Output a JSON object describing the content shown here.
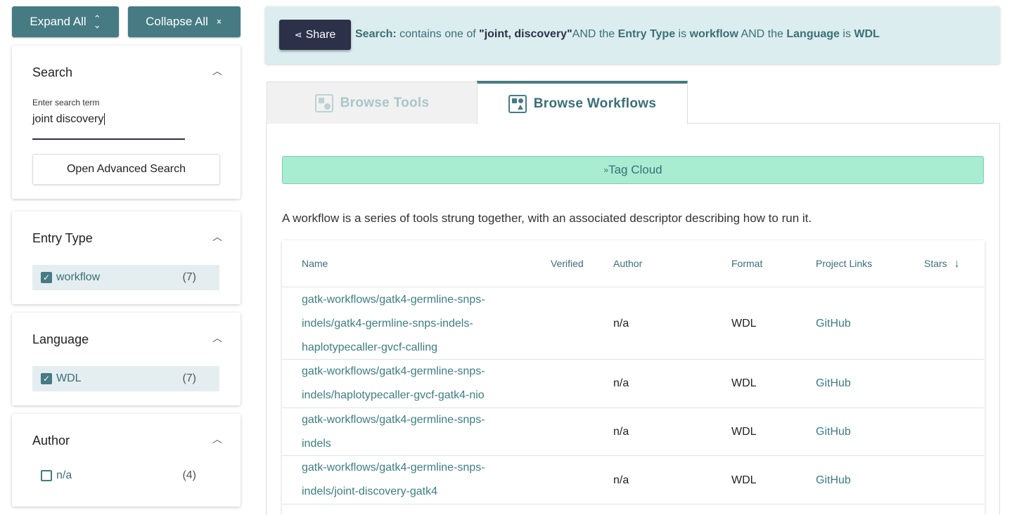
{
  "sidebar": {
    "expand_all": "Expand All",
    "collapse_all": "Collapse All",
    "search": {
      "title": "Search",
      "input_label": "Enter search term",
      "input_value": "joint discovery",
      "advanced_button": "Open Advanced Search"
    },
    "entry_type": {
      "title": "Entry Type",
      "items": [
        {
          "label": "workflow",
          "count": "(7)",
          "checked": true
        }
      ]
    },
    "language": {
      "title": "Language",
      "items": [
        {
          "label": "WDL",
          "count": "(7)",
          "checked": true
        }
      ]
    },
    "author": {
      "title": "Author",
      "items": [
        {
          "label": "n/a",
          "count": "(4)",
          "checked": false
        }
      ]
    }
  },
  "search_bar": {
    "share_label": "Share",
    "query_prefix": "Search:",
    "query_part1": " contains one of ",
    "query_terms": "\"joint, discovery\"",
    "query_part2": "AND the ",
    "entry_type_label": "Entry Type",
    "query_part3": " is ",
    "entry_type_value": "workflow",
    "query_part4": " AND the ",
    "language_label": "Language",
    "query_part5": " is ",
    "language_value": "WDL"
  },
  "tabs": [
    {
      "label": "Browse Tools",
      "active": false
    },
    {
      "label": "Browse Workflows",
      "active": true
    }
  ],
  "tag_cloud_label": "Tag Cloud",
  "description": "A workflow is a series of tools strung together, with an associated descriptor describing how to run it.",
  "table": {
    "headers": [
      "Name",
      "Verified",
      "Author",
      "Format",
      "Project Links",
      "Stars"
    ],
    "rows": [
      {
        "name_lines": [
          "gatk-workflows/gatk4-germline-snps-",
          "indels/gatk4-germline-snps-indels-",
          "haplotypecaller-gvcf-calling"
        ],
        "author": "n/a",
        "format": "WDL",
        "link": "GitHub"
      },
      {
        "name_lines": [
          "gatk-workflows/gatk4-germline-snps-",
          "indels/haplotypecaller-gvcf-gatk4-nio"
        ],
        "author": "n/a",
        "format": "WDL",
        "link": "GitHub"
      },
      {
        "name_lines": [
          "gatk-workflows/gatk4-germline-snps-",
          "indels"
        ],
        "author": "n/a",
        "format": "WDL",
        "link": "GitHub"
      },
      {
        "name_lines": [
          "gatk-workflows/gatk4-germline-snps-",
          "indels/joint-discovery-gatk4"
        ],
        "author": "n/a",
        "format": "WDL",
        "link": "GitHub"
      }
    ]
  },
  "colors": {
    "primary": "#467b83",
    "dark_button": "#2c3049",
    "search_bar_bg": "#dcedf0",
    "tag_cloud_bg": "#a8ecd2",
    "link": "#3f7c84"
  }
}
